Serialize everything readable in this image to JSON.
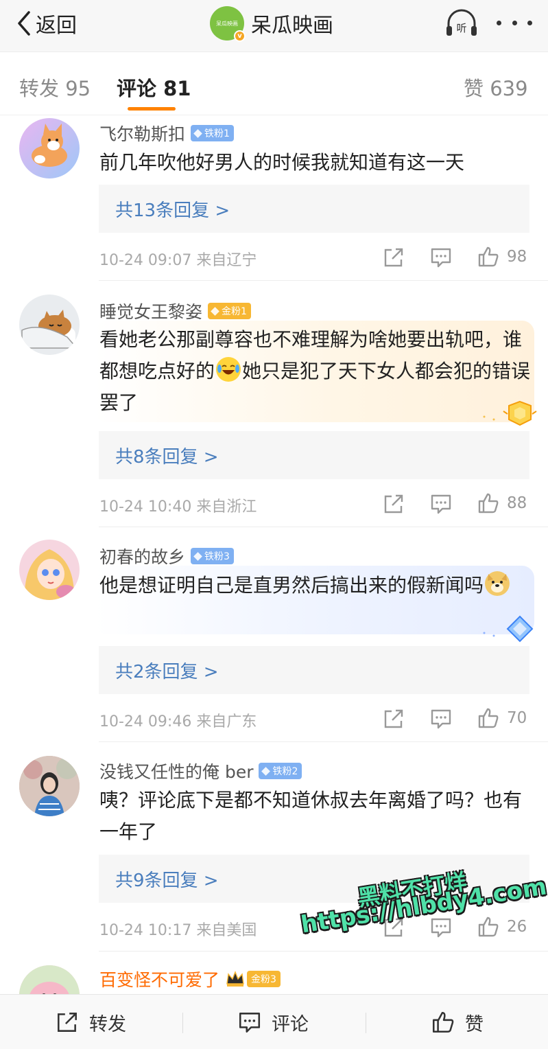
{
  "nav": {
    "back_label": "返回",
    "account_logo_text": "呆瓜映画",
    "account_name": "呆瓜映画",
    "listen_label": "听"
  },
  "tabs": {
    "repost": "转发 95",
    "comment": "评论 81",
    "like": "赞 639"
  },
  "comments": [
    {
      "username": "飞尔勒斯扣",
      "badge": "铁粉1",
      "badge_type": "iron",
      "text": "前几年吹他好男人的时候我就知道有这一天",
      "replies": "共13条回复 >",
      "time": "10-24 09:07",
      "location": "来自辽宁",
      "likes": "98",
      "avatar": "corgi"
    },
    {
      "username": "睡觉女王黎姿",
      "badge": "金粉1",
      "badge_type": "gold",
      "text_a": "看她老公那副尊容也不难理解为啥她要出轨吧，谁都想吃点好的",
      "emoji": "laugh-cry",
      "text_b": "她只是犯了天下女人都会犯的错误罢了",
      "replies": "共8条回复 >",
      "time": "10-24 10:40",
      "location": "来自浙江",
      "likes": "88",
      "avatar": "sleeping-cat"
    },
    {
      "username": "初春的故乡",
      "badge": "铁粉3",
      "badge_type": "iron",
      "text_a": "他是想证明自己是直男然后搞出来的假新闻吗",
      "emoji": "doge",
      "replies": "共2条回复 >",
      "time": "10-24 09:46",
      "location": "来自广东",
      "likes": "70",
      "avatar": "anime-girl"
    },
    {
      "username": "没钱又任性的俺 ber",
      "badge": "铁粉2",
      "badge_type": "iron",
      "text": "咦？评论底下是都不知道休叔去年离婚了吗？也有一年了",
      "replies": "共9条回复 >",
      "time": "10-24 10:17",
      "location": "来自美国",
      "likes": "26",
      "avatar": "photo-person"
    },
    {
      "username": "百变怪不可爱了",
      "badge": "金粉3",
      "badge_type": "gold",
      "avatar": "pink-creature"
    }
  ],
  "watermark": {
    "line1": "黑料不打烊",
    "line2": "https://hlbdy4.com"
  },
  "bottom": {
    "repost": "转发",
    "comment": "评论",
    "like": "赞"
  },
  "colors": {
    "tab_underline": "#ff8200",
    "reply_link": "#4a7ebd",
    "iron_badge": "#7fb0f2",
    "gold_badge": "#f7b733",
    "vip_name": "#ff6a00",
    "watermark": "#4fe1a8"
  }
}
